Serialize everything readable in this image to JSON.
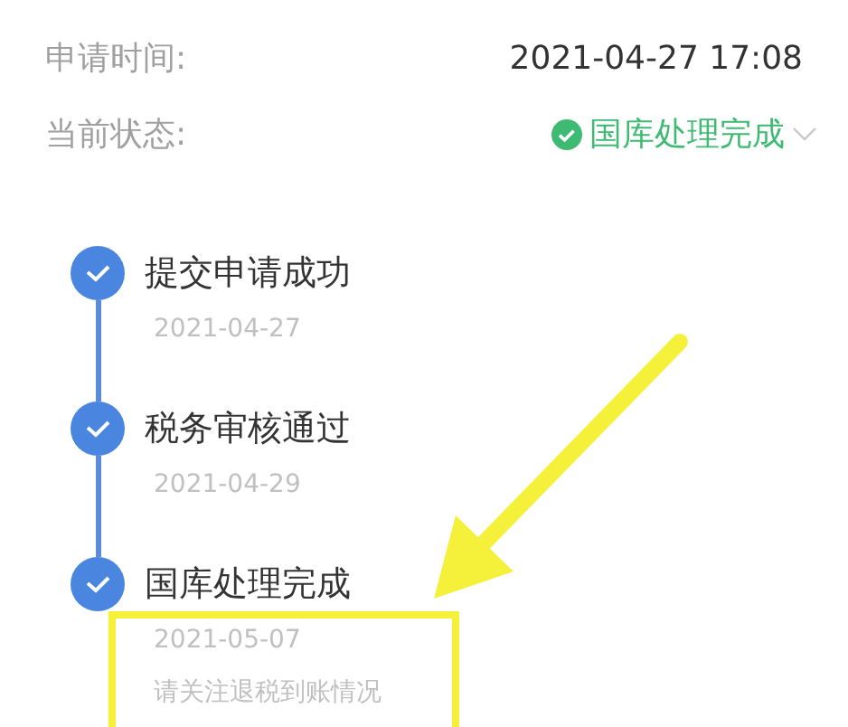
{
  "fields": [
    {
      "label": "申请时间:",
      "value": "2021-04-27 17:08",
      "kind": "text"
    },
    {
      "label": "当前状态:",
      "value": "国库处理完成",
      "kind": "status",
      "done": true
    }
  ],
  "steps": [
    {
      "title": "提交申请成功",
      "date": "2021-04-27",
      "completed": true
    },
    {
      "title": "税务审核通过",
      "date": "2021-04-29",
      "completed": true
    },
    {
      "title": "国库处理完成",
      "date": "2021-05-07",
      "note": "请关注退税到账情况",
      "completed": true
    }
  ]
}
